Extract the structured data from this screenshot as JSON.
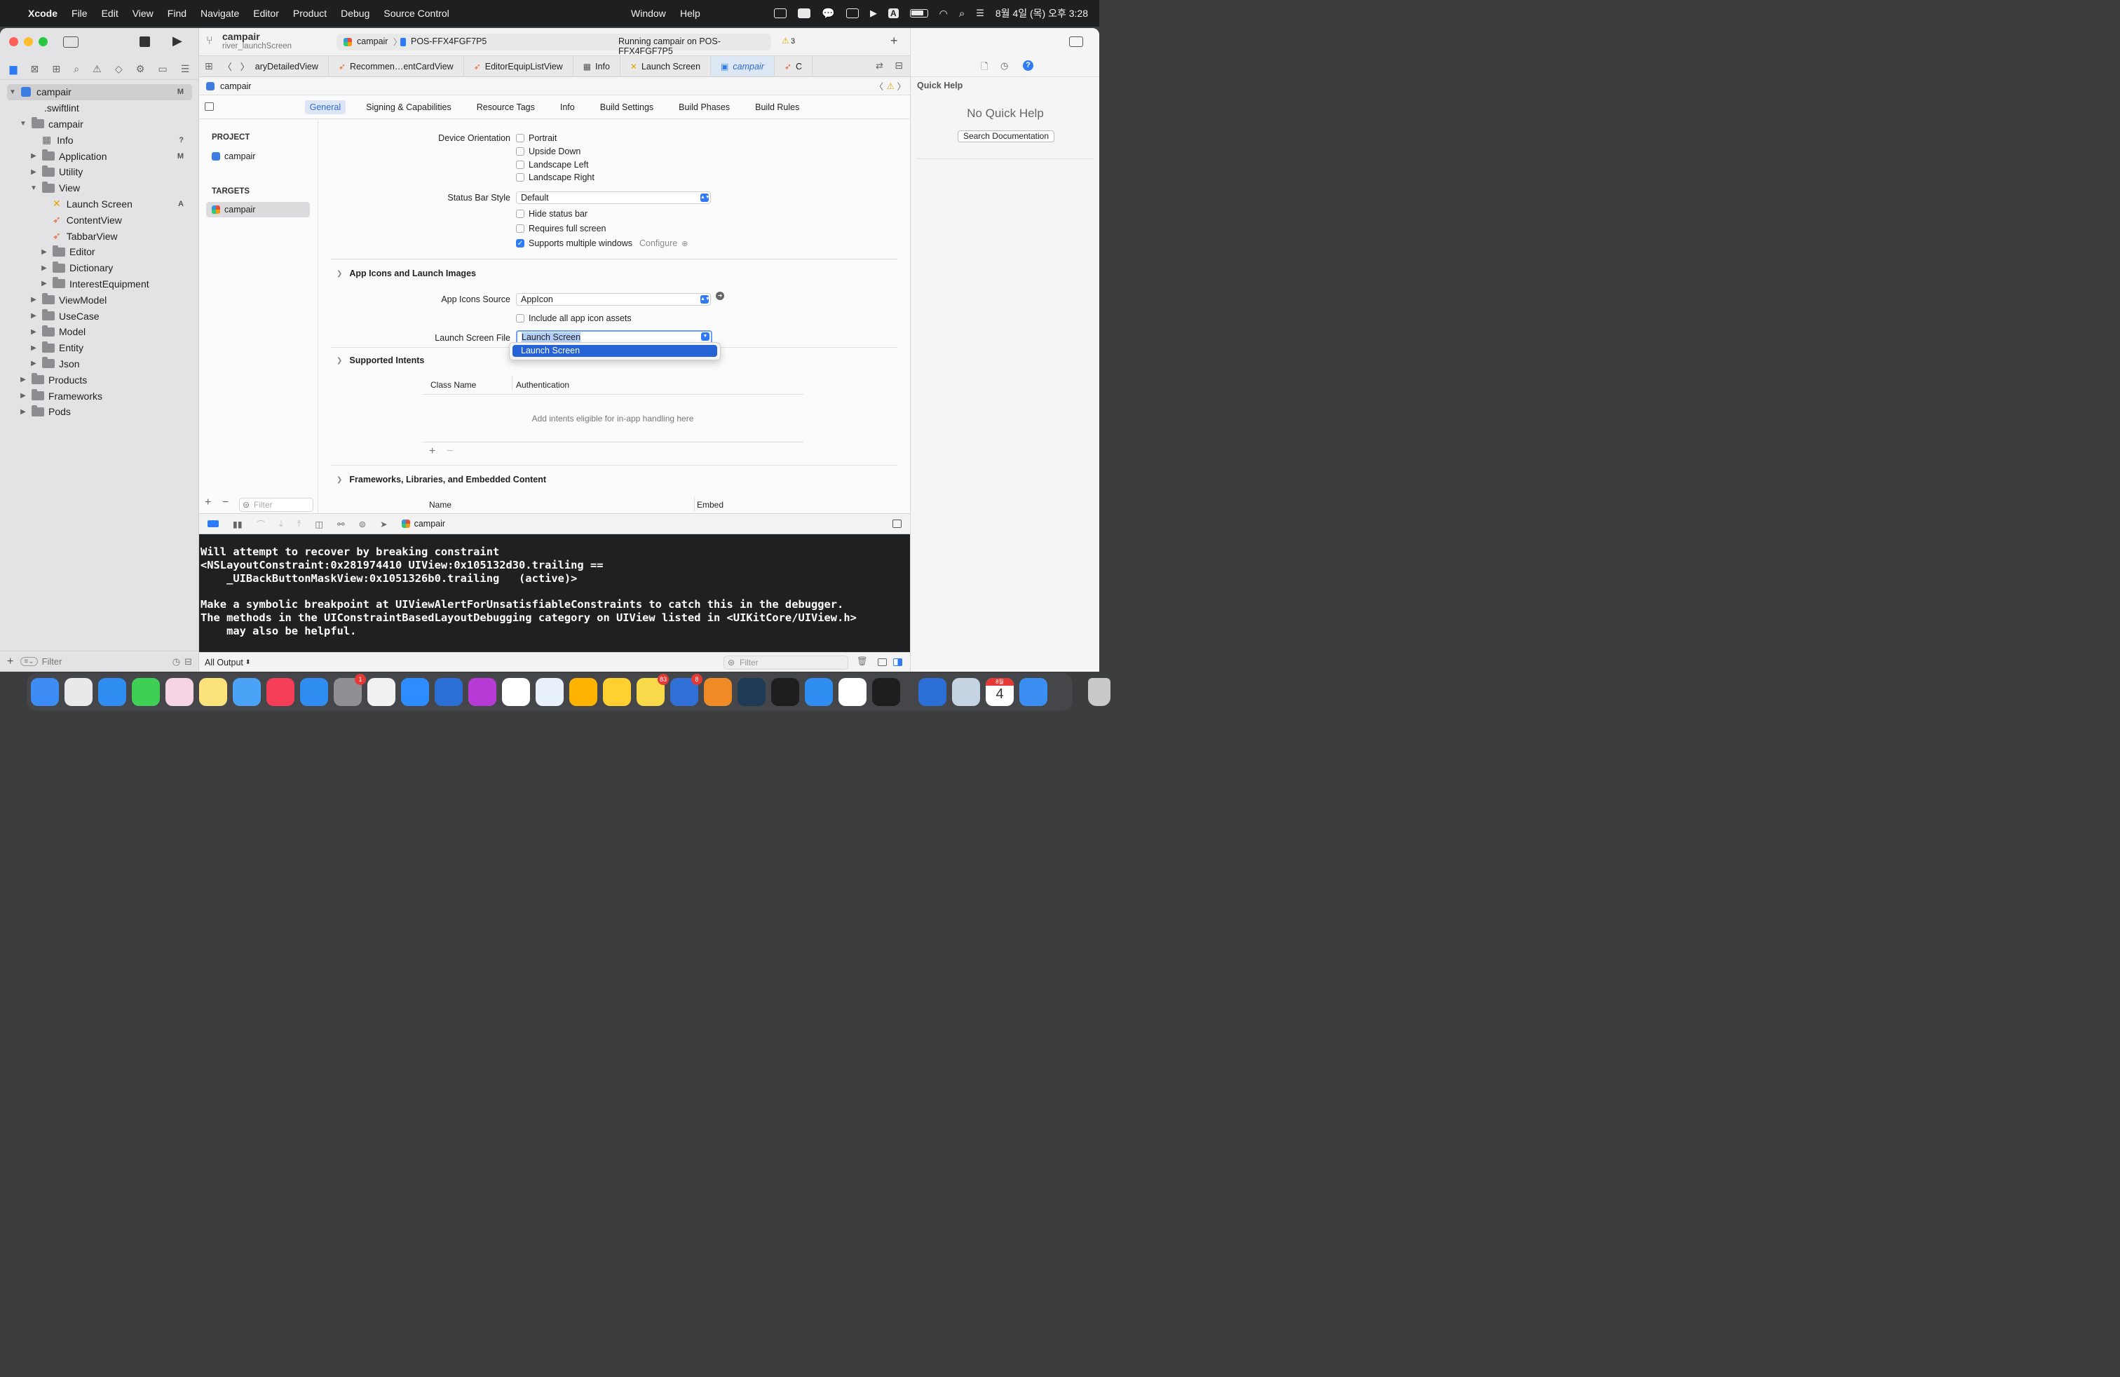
{
  "menubar": {
    "app": "Xcode",
    "items": [
      "File",
      "Edit",
      "View",
      "Find",
      "Navigate",
      "Editor",
      "Product",
      "Debug",
      "Source Control"
    ],
    "right_items": [
      "Window",
      "Help"
    ],
    "clock": "8월 4일 (목) 오후 3:28",
    "input_indicator": "A"
  },
  "toolbar": {
    "project": "campair",
    "branch": "river_launchScreen",
    "scheme": "campair",
    "device": "POS-FFX4FGF7P5",
    "status": "Running campair on POS-FFX4FGF7P5",
    "warnings": "3"
  },
  "navigator": {
    "items": [
      {
        "label": "campair",
        "level": 0,
        "type": "app",
        "badge": "M",
        "disclosure": "open",
        "selected": true
      },
      {
        "label": ".swiftlint",
        "level": 1,
        "type": "file",
        "badge": "",
        "disclosure": ""
      },
      {
        "label": "campair",
        "level": 1,
        "type": "folder",
        "badge": "",
        "disclosure": "open"
      },
      {
        "label": "Info",
        "level": 2,
        "type": "plist",
        "badge": "?",
        "disclosure": ""
      },
      {
        "label": "Application",
        "level": 2,
        "type": "folder",
        "badge": "M",
        "disclosure": "closed"
      },
      {
        "label": "Utility",
        "level": 2,
        "type": "folder",
        "badge": "",
        "disclosure": "closed"
      },
      {
        "label": "View",
        "level": 2,
        "type": "folder",
        "badge": "",
        "disclosure": "open"
      },
      {
        "label": "Launch Screen",
        "level": 3,
        "type": "storyboard",
        "badge": "A",
        "disclosure": ""
      },
      {
        "label": "ContentView",
        "level": 3,
        "type": "swift",
        "badge": "",
        "disclosure": ""
      },
      {
        "label": "TabbarView",
        "level": 3,
        "type": "swift",
        "badge": "",
        "disclosure": ""
      },
      {
        "label": "Editor",
        "level": 3,
        "type": "folder",
        "badge": "",
        "disclosure": "closed"
      },
      {
        "label": "Dictionary",
        "level": 3,
        "type": "folder",
        "badge": "",
        "disclosure": "closed"
      },
      {
        "label": "InterestEquipment",
        "level": 3,
        "type": "folder",
        "badge": "",
        "disclosure": "closed"
      },
      {
        "label": "ViewModel",
        "level": 2,
        "type": "folder",
        "badge": "",
        "disclosure": "closed"
      },
      {
        "label": "UseCase",
        "level": 2,
        "type": "folder",
        "badge": "",
        "disclosure": "closed"
      },
      {
        "label": "Model",
        "level": 2,
        "type": "folder",
        "badge": "",
        "disclosure": "closed"
      },
      {
        "label": "Entity",
        "level": 2,
        "type": "folder",
        "badge": "",
        "disclosure": "closed"
      },
      {
        "label": "Json",
        "level": 2,
        "type": "folder",
        "badge": "",
        "disclosure": "closed"
      },
      {
        "label": "Products",
        "level": 1,
        "type": "folder",
        "badge": "",
        "disclosure": "closed"
      },
      {
        "label": "Frameworks",
        "level": 1,
        "type": "folder",
        "badge": "",
        "disclosure": "closed"
      },
      {
        "label": "Pods",
        "level": 1,
        "type": "folder",
        "badge": "",
        "disclosure": "closed"
      }
    ],
    "filter_placeholder": "Filter"
  },
  "tabs": [
    {
      "label": "aryDetailedView",
      "icon": "swift-icon",
      "active": false
    },
    {
      "label": "Recommen…entCardView",
      "icon": "swift-icon",
      "active": false
    },
    {
      "label": "EditorEquipListView",
      "icon": "swift-icon",
      "active": false
    },
    {
      "label": "Info",
      "icon": "table-icon",
      "active": false
    },
    {
      "label": "Launch Screen",
      "icon": "storyboard-icon",
      "active": false
    },
    {
      "label": "campair",
      "icon": "project-icon",
      "active": true
    },
    {
      "label": "C",
      "icon": "swift-icon",
      "active": false
    }
  ],
  "jumpbar": {
    "path": "campair"
  },
  "project_tabs": [
    "General",
    "Signing & Capabilities",
    "Resource Tags",
    "Info",
    "Build Settings",
    "Build Phases",
    "Build Rules"
  ],
  "project_list": {
    "project_header": "PROJECT",
    "project_item": "campair",
    "targets_header": "TARGETS",
    "target_item": "campair",
    "filter_placeholder": "Filter"
  },
  "settings": {
    "device_orientation": {
      "label": "Device Orientation",
      "options": [
        {
          "label": "Portrait",
          "checked": false
        },
        {
          "label": "Upside Down",
          "checked": false
        },
        {
          "label": "Landscape Left",
          "checked": false
        },
        {
          "label": "Landscape Right",
          "checked": false
        }
      ]
    },
    "status_bar_style": {
      "label": "Status Bar Style",
      "value": "Default"
    },
    "status_options": [
      {
        "label": "Hide status bar",
        "checked": false
      },
      {
        "label": "Requires full screen",
        "checked": false
      },
      {
        "label": "Supports multiple windows",
        "checked": true
      }
    ],
    "configure": "Configure",
    "app_icons_section": "App Icons and Launch Images",
    "app_icons_source": {
      "label": "App Icons Source",
      "value": "AppIcon"
    },
    "include_all": {
      "label": "Include all app icon assets",
      "checked": false
    },
    "launch_screen_file": {
      "label": "Launch Screen File",
      "value": "Launch Screen"
    },
    "dropdown_option": "Launch Screen",
    "intents_section": "Supported Intents",
    "intents_columns": [
      "Class Name",
      "Authentication"
    ],
    "intents_empty": "Add intents eligible for in-app handling here",
    "frameworks_section": "Frameworks, Libraries, and Embedded Content",
    "frameworks_columns": [
      "Name",
      "Embed"
    ]
  },
  "debugbar": {
    "target": "campair"
  },
  "console": {
    "lines": [
      "Will attempt to recover by breaking constraint",
      "<NSLayoutConstraint:0x281974410 UIView:0x105132d30.trailing ==",
      "    _UIBackButtonMaskView:0x1051326b0.trailing   (active)>",
      "",
      "Make a symbolic breakpoint at UIViewAlertForUnsatisfiableConstraints to catch this in the debugger.",
      "The methods in the UIConstraintBasedLayoutDebugging category on UIView listed in <UIKitCore/UIView.h>",
      "    may also be helpful."
    ],
    "output_selector": "All Output",
    "filter_placeholder": "Filter"
  },
  "quick_help": {
    "title": "Quick Help",
    "empty": "No Quick Help",
    "button": "Search Documentation"
  },
  "dock": {
    "apps": [
      {
        "name": "finder",
        "color": "#3d8cf5",
        "badge": ""
      },
      {
        "name": "launchpad",
        "color": "#e9e9ec",
        "badge": ""
      },
      {
        "name": "safari",
        "color": "#2f8cf0",
        "badge": ""
      },
      {
        "name": "messages",
        "color": "#3fcf55",
        "badge": ""
      },
      {
        "name": "photos",
        "color": "#f7d4e4",
        "badge": ""
      },
      {
        "name": "notes",
        "color": "#fbe27a",
        "badge": ""
      },
      {
        "name": "mail",
        "color": "#4aa3f7",
        "badge": ""
      },
      {
        "name": "music",
        "color": "#f43e57",
        "badge": ""
      },
      {
        "name": "app-store",
        "color": "#2f8cf0",
        "badge": ""
      },
      {
        "name": "system-preferences",
        "color": "#8e8e93",
        "badge": "1"
      },
      {
        "name": "chrome",
        "color": "#f1f1f1",
        "badge": ""
      },
      {
        "name": "zoom",
        "color": "#2d8cff",
        "badge": ""
      },
      {
        "name": "xcode",
        "color": "#2a6ed6",
        "badge": ""
      },
      {
        "name": "sound-app",
        "color": "#b83ad6",
        "badge": ""
      },
      {
        "name": "notion",
        "color": "#ffffff",
        "badge": ""
      },
      {
        "name": "sourcetree",
        "color": "#e8f0fb",
        "badge": ""
      },
      {
        "name": "sketch",
        "color": "#fdb300",
        "badge": ""
      },
      {
        "name": "miro",
        "color": "#ffd02f",
        "badge": ""
      },
      {
        "name": "kakaotalk",
        "color": "#f7d94a",
        "badge": "83"
      },
      {
        "name": "bird-app",
        "color": "#2f6fd6",
        "badge": "8"
      },
      {
        "name": "books",
        "color": "#f08a24",
        "badge": ""
      },
      {
        "name": "cyberduck",
        "color": "#1f3b55",
        "badge": ""
      },
      {
        "name": "terminal",
        "color": "#1e1e1e",
        "badge": ""
      },
      {
        "name": "app-store-2",
        "color": "#2f8cf0",
        "badge": ""
      },
      {
        "name": "slack",
        "color": "#ffffff",
        "badge": ""
      },
      {
        "name": "figma",
        "color": "#1e1e1e",
        "badge": ""
      },
      {
        "name": "xcode-2",
        "color": "#2a6ed6",
        "badge": ""
      },
      {
        "name": "preview",
        "color": "#c6d3e3",
        "badge": ""
      },
      {
        "name": "calendar",
        "color": "#ffffff",
        "badge": ""
      },
      {
        "name": "keynote",
        "color": "#3b8ff2",
        "badge": ""
      },
      {
        "name": "trash",
        "color": "#c9c9cc",
        "badge": ""
      }
    ],
    "calendar_month": "8월",
    "calendar_day": "4"
  },
  "colors": {
    "accent": "#2f7bf6",
    "selection": "#2462d6",
    "console_bg": "#1f2022",
    "swift_orange": "#e0632b",
    "warning": "#e7a400"
  }
}
